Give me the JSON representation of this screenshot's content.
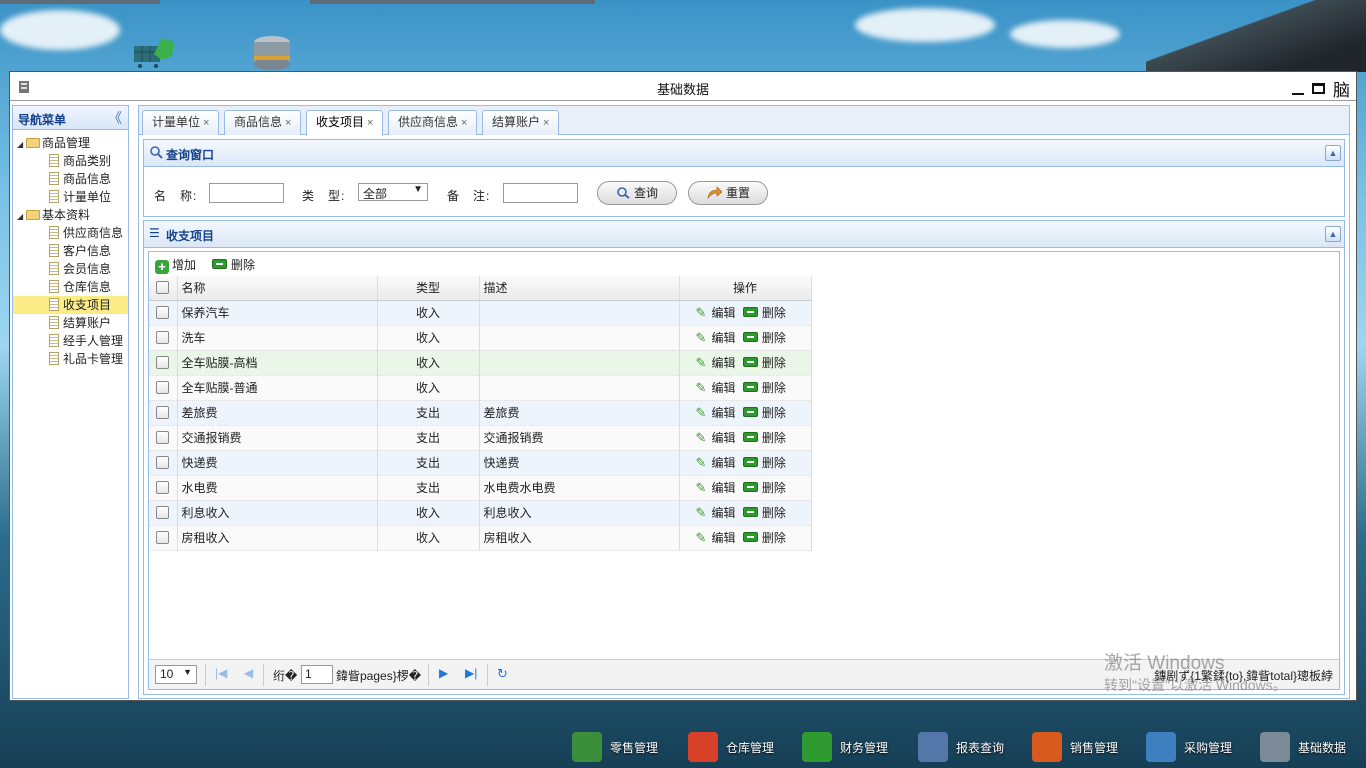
{
  "window": {
    "title": "基础数据",
    "corner_glyph": "脑"
  },
  "nav": {
    "title": "导航菜单",
    "collapse_glyph": "《",
    "groups": [
      {
        "label": "商品管理",
        "items": [
          "商品类别",
          "商品信息",
          "计量单位"
        ]
      },
      {
        "label": "基本资料",
        "items": [
          "供应商信息",
          "客户信息",
          "会员信息",
          "仓库信息",
          "收支项目",
          "结算账户",
          "经手人管理",
          "礼品卡管理"
        ]
      }
    ],
    "selected": "收支项目"
  },
  "tabs": [
    {
      "label": "计量单位",
      "close": "×"
    },
    {
      "label": "商品信息",
      "close": "×"
    },
    {
      "label": "收支项目",
      "close": "×",
      "active": true
    },
    {
      "label": "供应商信息",
      "close": "×"
    },
    {
      "label": "结算账户",
      "close": "×"
    }
  ],
  "query": {
    "title": "查询窗口",
    "name_label": "名　称:",
    "type_label": "类　型:",
    "type_value": "全部",
    "note_label": "备　注:",
    "search_btn": "查询",
    "reset_btn": "重置"
  },
  "list": {
    "title": "收支项目",
    "add_label": "增加",
    "delete_label": "删除",
    "columns": {
      "name": "名称",
      "type": "类型",
      "desc": "描述",
      "ops": "操作"
    },
    "edit_label": "编辑",
    "row_delete_label": "删除",
    "rows": [
      {
        "name": "保养汽车",
        "type": "收入",
        "desc": ""
      },
      {
        "name": "洗车",
        "type": "收入",
        "desc": ""
      },
      {
        "name": "全车贴膜-高档",
        "type": "收入",
        "desc": ""
      },
      {
        "name": "全车贴膜-普通",
        "type": "收入",
        "desc": ""
      },
      {
        "name": "差旅费",
        "type": "支出",
        "desc": "差旅费"
      },
      {
        "name": "交通报销费",
        "type": "支出",
        "desc": "交通报销费"
      },
      {
        "name": "快递费",
        "type": "支出",
        "desc": "快递费"
      },
      {
        "name": "水电费",
        "type": "支出",
        "desc": "水电费水电费"
      },
      {
        "name": "利息收入",
        "type": "收入",
        "desc": "利息收入"
      },
      {
        "name": "房租收入",
        "type": "收入",
        "desc": "房租收入"
      }
    ]
  },
  "pager": {
    "page_size": "10",
    "before_page": "绗�",
    "page_num": "1",
    "after_page": "鍏眥pages}椤�",
    "summary": "鏄剧ず{1繁鍒{to},鍏眥total}璁板綍"
  },
  "watermark": {
    "line1": "激活 Windows",
    "line2": "转到\"设置\"以激活 Windows。"
  },
  "taskbar": [
    {
      "label": "零售管理",
      "color": "#3c8f3a"
    },
    {
      "label": "仓库管理",
      "color": "#d8402a"
    },
    {
      "label": "财务管理",
      "color": "#2f9a2f"
    },
    {
      "label": "报表查询",
      "color": "#5576a8"
    },
    {
      "label": "销售管理",
      "color": "#d85a1e"
    },
    {
      "label": "采购管理",
      "color": "#3d7fbf"
    },
    {
      "label": "基础数据",
      "color": "#7a8a96"
    }
  ]
}
